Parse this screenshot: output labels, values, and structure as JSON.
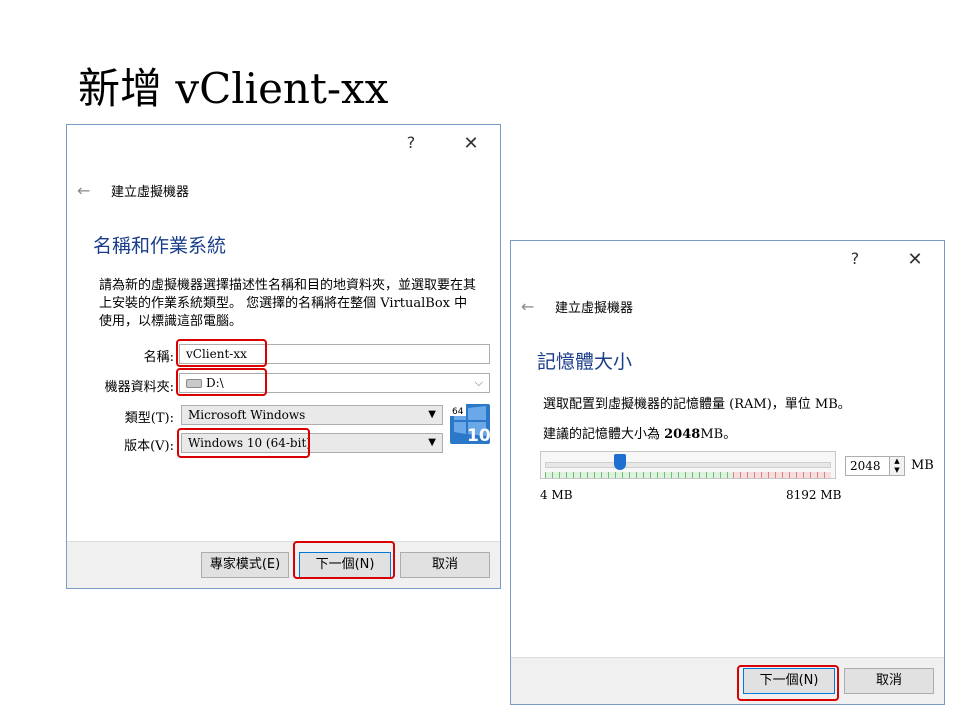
{
  "slide": {
    "title": "新增 vClient-xx"
  },
  "dialog1": {
    "help": "?",
    "close": "✕",
    "back": "←",
    "nav_title": "建立虛擬機器",
    "heading": "名稱和作業系統",
    "description": "請為新的虛擬機器選擇描述性名稱和目的地資料夾，並選取要在其上安裝的作業系統類型。 您選擇的名稱將在整個 VirtualBox 中使用，以標識這部電腦。",
    "name_label": "名稱:",
    "name_value": "vClient-xx",
    "folder_label": "機器資料夾:",
    "folder_value": "D:\\",
    "type_label": "類型(T):",
    "type_value": "Microsoft Windows",
    "version_label": "版本(V):",
    "version_value": "Windows 10 (64-bit)",
    "os_badge": "10",
    "os_bits": "64",
    "expert_button": "專家模式(E)",
    "next_button": "下一個(N)",
    "cancel_button": "取消"
  },
  "dialog2": {
    "help": "?",
    "close": "✕",
    "back": "←",
    "nav_title": "建立虛擬機器",
    "heading": "記憶體大小",
    "description": "選取配置到虛擬機器的記憶體量 (RAM)，單位 MB。",
    "suggest_prefix": "建議的記憶體大小為 ",
    "suggest_value": "2048",
    "suggest_suffix": "MB。",
    "memory_value": "2048",
    "memory_fraction": 0.25,
    "unit": "MB",
    "min_label": "4 MB",
    "max_label": "8192 MB",
    "next_button": "下一個(N)",
    "cancel_button": "取消"
  },
  "colors": {
    "highlight": "#d80000",
    "heading": "#1a3e8a",
    "accent": "#0078d7"
  }
}
